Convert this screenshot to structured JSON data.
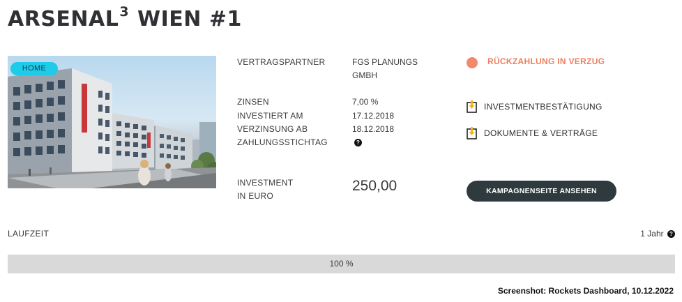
{
  "campaign": {
    "title_main": "ARSENAL",
    "title_sup": "3",
    "title_rest": "WIEN #1",
    "badge": "HOME"
  },
  "details": {
    "partner_label": "VERTRAGSPARTNER",
    "partner_value_line1": "FGS PLANUNGS",
    "partner_value_line2": "GMBH",
    "interest_label": "ZINSEN",
    "interest_value": "7,00 %",
    "invested_label": "INVESTIERT AM",
    "invested_value": "17.12.2018",
    "accrual_label": "VERZINSUNG AB",
    "accrual_value": "18.12.2018",
    "payment_label": "ZAHLUNGSSTICHTAG",
    "help_glyph": "?",
    "investment_label_line1": "INVESTMENT",
    "investment_label_line2": "IN EURO",
    "investment_value": "250,00"
  },
  "status": {
    "text": "RÜCKZAHLUNG IN VERZUG",
    "color": "#ef7e5c"
  },
  "documents": [
    {
      "label": "INVESTMENTBESTÄTIGUNG",
      "icon": "document-download-icon"
    },
    {
      "label": "DOKUMENTE & VERTRÄGE",
      "icon": "document-download-icon"
    }
  ],
  "cta_label": "KAMPAGNENSEITE ANSEHEN",
  "runtime": {
    "label": "LAUFZEIT",
    "value": "1 Jahr"
  },
  "progress": {
    "percent": 100,
    "text": "100 %"
  },
  "caption": "Screenshot: Rockets Dashboard, 10.12.2022"
}
